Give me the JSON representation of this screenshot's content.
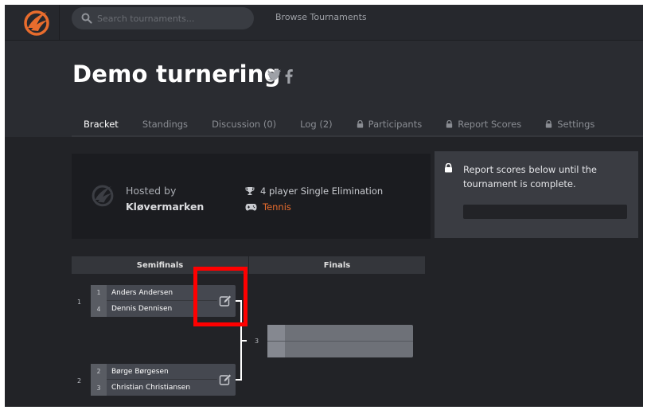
{
  "colors": {
    "accent": "#e86c2d",
    "nav_bg": "#26282d",
    "page_bg": "#2a2c31",
    "content_bg": "#222327",
    "highlight": "#ff0000"
  },
  "topnav": {
    "search_placeholder": "Search tournaments...",
    "browse_label": "Browse Tournaments",
    "logo_icon": "challonge-flame-logo"
  },
  "header": {
    "title": "Demo turnering",
    "social_icons": [
      "twitter-icon",
      "facebook-icon"
    ]
  },
  "tabs": [
    {
      "label": "Bracket",
      "active": true,
      "locked": false
    },
    {
      "label": "Standings",
      "active": false,
      "locked": false
    },
    {
      "label": "Discussion (0)",
      "active": false,
      "locked": false
    },
    {
      "label": "Log (2)",
      "active": false,
      "locked": false
    },
    {
      "label": "Participants",
      "active": false,
      "locked": true
    },
    {
      "label": "Report Scores",
      "active": false,
      "locked": true
    },
    {
      "label": "Settings",
      "active": false,
      "locked": true
    }
  ],
  "host": {
    "hosted_by_label": "Hosted by",
    "host_name": "Kløvermarken",
    "format": "4 player Single Elimination",
    "game": "Tennis"
  },
  "report": {
    "message": "Report scores below until the tournament is complete."
  },
  "bracket": {
    "rounds": [
      "Semifinals",
      "Finals"
    ],
    "matches": [
      {
        "number": "1",
        "players": [
          {
            "seed": "1",
            "name": "Anders Andersen"
          },
          {
            "seed": "4",
            "name": "Dennis Dennisen"
          }
        ]
      },
      {
        "number": "2",
        "players": [
          {
            "seed": "2",
            "name": "Børge Børgesen"
          },
          {
            "seed": "3",
            "name": "Christian Christiansen"
          }
        ]
      }
    ],
    "final": {
      "number": "3"
    }
  }
}
